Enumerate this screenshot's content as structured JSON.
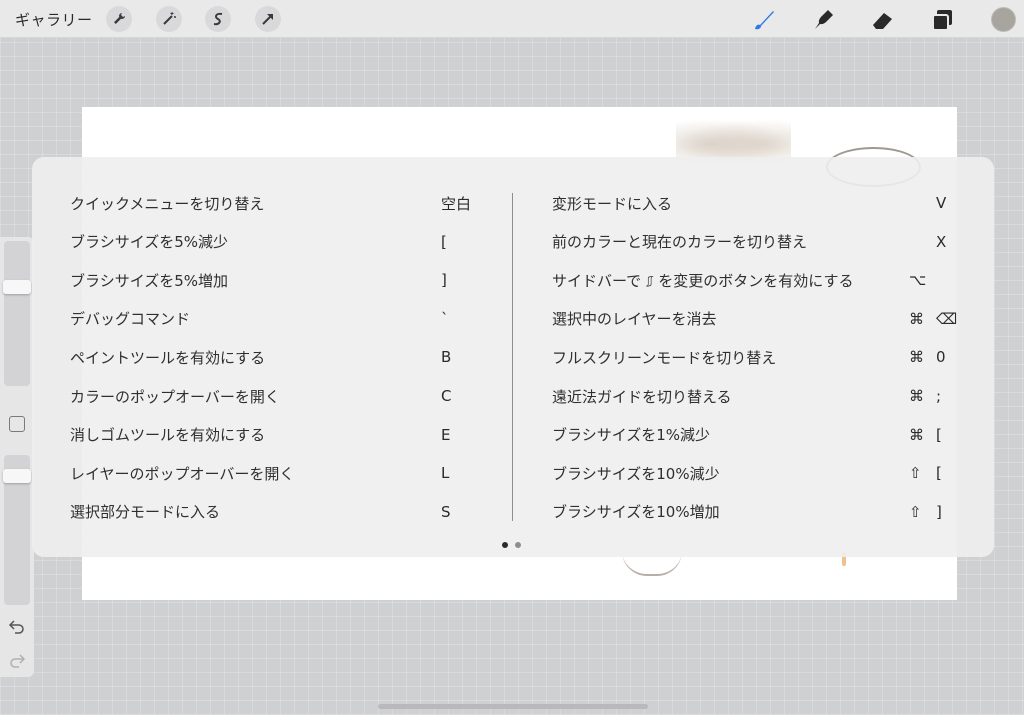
{
  "toolbar": {
    "gallery_label": "ギャラリー",
    "left_tools": [
      "wrench-icon",
      "magic-wand-icon",
      "selection-icon",
      "transform-arrow-icon"
    ],
    "right_tools": [
      "brush-icon",
      "smudge-icon",
      "eraser-icon",
      "layers-icon"
    ],
    "active_tool": "brush-icon",
    "active_color": "#2f7ae5",
    "current_color": "#a8a49e"
  },
  "shortcuts": {
    "left": [
      {
        "label": "クイックメニューを切り替え",
        "key": "空白"
      },
      {
        "label": "ブラシサイズを5%減少",
        "key": "["
      },
      {
        "label": "ブラシサイズを5%増加",
        "key": "]"
      },
      {
        "label": "デバッグコマンド",
        "key": "`"
      },
      {
        "label": "ペイントツールを有効にする",
        "key": "B"
      },
      {
        "label": "カラーのポップオーバーを開く",
        "key": "C"
      },
      {
        "label": "消しゴムツールを有効にする",
        "key": "E"
      },
      {
        "label": "レイヤーのポップオーバーを開く",
        "key": "L"
      },
      {
        "label": "選択部分モードに入る",
        "key": "S"
      }
    ],
    "right": [
      {
        "label": "変形モードに入る",
        "mod": "",
        "key": "V"
      },
      {
        "label": "前のカラーと現在のカラーを切り替え",
        "mod": "",
        "key": "X"
      },
      {
        "label": "サイドバーで ⎎ を変更のボタンを有効にする",
        "mod": "",
        "key": "⌥"
      },
      {
        "label": "選択中のレイヤーを消去",
        "mod": "⌘",
        "key": "⌫"
      },
      {
        "label": "フルスクリーンモードを切り替え",
        "mod": "⌘",
        "key": "0"
      },
      {
        "label": "遠近法ガイドを切り替える",
        "mod": "⌘",
        "key": ";"
      },
      {
        "label": "ブラシサイズを1%減少",
        "mod": "⌘",
        "key": "["
      },
      {
        "label": "ブラシサイズを10%減少",
        "mod": "⇧",
        "key": "["
      },
      {
        "label": "ブラシサイズを10%増加",
        "mod": "⇧",
        "key": "]"
      }
    ],
    "pages": {
      "count": 2,
      "current": 1
    }
  },
  "sidebar": {
    "brush_size_level": 0.7,
    "opacity_level": 0.9,
    "undo_icon": "undo-icon",
    "redo_icon": "redo-icon"
  }
}
